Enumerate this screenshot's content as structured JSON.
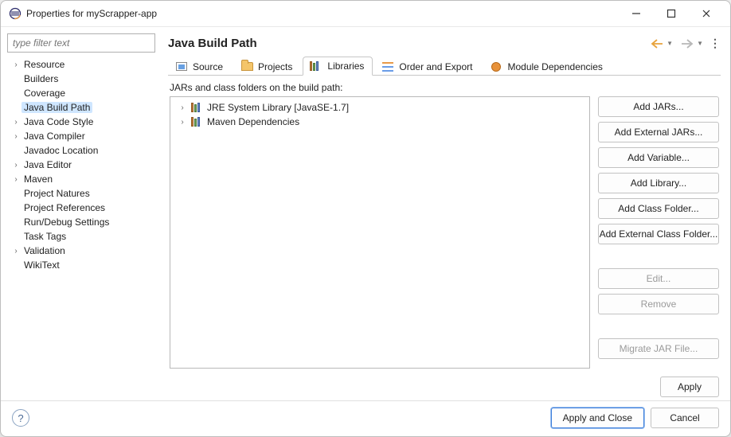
{
  "window": {
    "title": "Properties for myScrapper-app"
  },
  "sidebar": {
    "filter_placeholder": "type filter text",
    "items": [
      {
        "label": "Resource",
        "expandable": true
      },
      {
        "label": "Builders",
        "expandable": false
      },
      {
        "label": "Coverage",
        "expandable": false
      },
      {
        "label": "Java Build Path",
        "expandable": false,
        "selected": true
      },
      {
        "label": "Java Code Style",
        "expandable": true
      },
      {
        "label": "Java Compiler",
        "expandable": true
      },
      {
        "label": "Javadoc Location",
        "expandable": false
      },
      {
        "label": "Java Editor",
        "expandable": true
      },
      {
        "label": "Maven",
        "expandable": true
      },
      {
        "label": "Project Natures",
        "expandable": false
      },
      {
        "label": "Project References",
        "expandable": false
      },
      {
        "label": "Run/Debug Settings",
        "expandable": false
      },
      {
        "label": "Task Tags",
        "expandable": false
      },
      {
        "label": "Validation",
        "expandable": true
      },
      {
        "label": "WikiText",
        "expandable": false
      }
    ]
  },
  "main": {
    "title": "Java Build Path",
    "tabs": [
      {
        "label": "Source",
        "icon": "source"
      },
      {
        "label": "Projects",
        "icon": "folder"
      },
      {
        "label": "Libraries",
        "icon": "lib",
        "active": true
      },
      {
        "label": "Order and Export",
        "icon": "order"
      },
      {
        "label": "Module Dependencies",
        "icon": "module"
      }
    ],
    "subtitle": "JARs and class folders on the build path:",
    "lib_items": [
      {
        "label": "JRE System Library [JavaSE-1.7]"
      },
      {
        "label": "Maven Dependencies"
      }
    ],
    "buttons": [
      {
        "label": "Add JARs...",
        "enabled": true
      },
      {
        "label": "Add External JARs...",
        "enabled": true
      },
      {
        "label": "Add Variable...",
        "enabled": true
      },
      {
        "label": "Add Library...",
        "enabled": true
      },
      {
        "label": "Add Class Folder...",
        "enabled": true
      },
      {
        "label": "Add External Class Folder...",
        "enabled": true
      },
      {
        "label": "Edit...",
        "enabled": false
      },
      {
        "label": "Remove",
        "enabled": false
      },
      {
        "label": "Migrate JAR File...",
        "enabled": false
      }
    ],
    "apply_label": "Apply"
  },
  "footer": {
    "apply_close_label": "Apply and Close",
    "cancel_label": "Cancel"
  }
}
